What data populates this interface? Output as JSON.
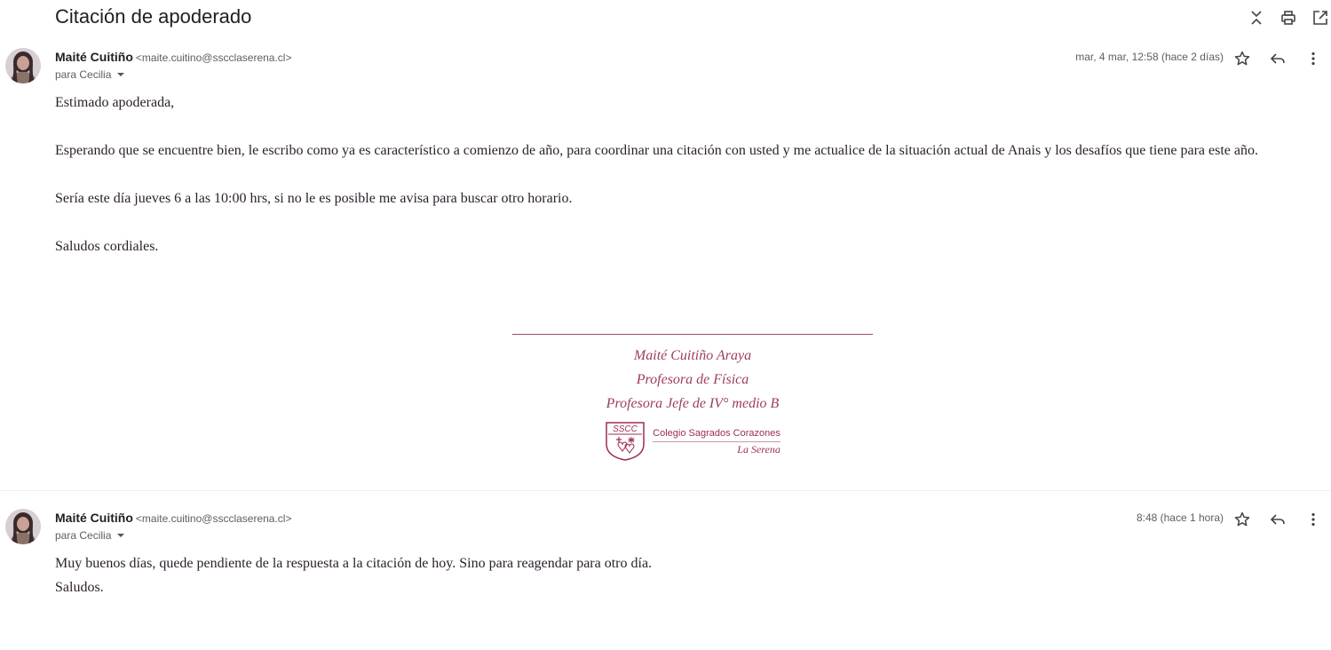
{
  "thread": {
    "subject": "Citación de apoderado",
    "top_actions": [
      "collapse-all-icon",
      "print-icon",
      "open-in-new-window-icon"
    ]
  },
  "messages": [
    {
      "sender_name": "Maité Cuitiño",
      "sender_email": "<maite.cuitino@sscclaserena.cl>",
      "recipient": "para Cecilia",
      "date": "mar, 4 mar, 12:58 (hace 2 días)",
      "body": [
        "Estimado apoderada,",
        "Esperando que se encuentre bien,  le escribo como ya es característico a comienzo de año, para coordinar una citación con usted y me actualice de la situación actual de Anais y los desafíos que tiene para este año.",
        "Sería este día jueves 6 a las 10:00 hrs, si no le es posible me avisa para buscar otro horario.",
        "Saludos cordiales."
      ],
      "signature": {
        "name": "Maité Cuitiño Araya",
        "role": "Profesora de Física",
        "title": "Profesora Jefe de IV° medio B",
        "logo_badge": "SSCC",
        "logo_school": "Colegio Sagrados Corazones",
        "logo_city": "La Serena"
      }
    },
    {
      "sender_name": "Maité Cuitiño",
      "sender_email": "<maite.cuitino@sscclaserena.cl>",
      "recipient": "para Cecilia",
      "date": "8:48 (hace 1 hora)",
      "body": [
        "Muy buenos días, quede pendiente de la respuesta a la citación de hoy. Sino para reagendar para otro día.",
        "Saludos."
      ]
    }
  ],
  "colors": {
    "signature": "#9c3c5f",
    "body_text": "#2a1f2a",
    "meta_text": "#5e5e5e"
  }
}
